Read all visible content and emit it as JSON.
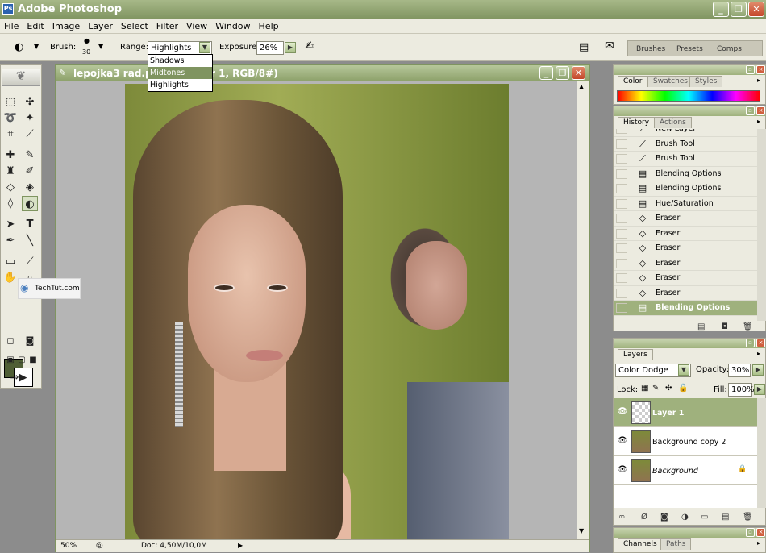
{
  "app": {
    "title": "Adobe Photoshop",
    "logo": "Ps",
    "window_buttons": {
      "minimize": "_",
      "restore": "❐",
      "close": "✕"
    }
  },
  "menu": [
    "File",
    "Edit",
    "Image",
    "Layer",
    "Select",
    "Filter",
    "View",
    "Window",
    "Help"
  ],
  "options": {
    "brush_label": "Brush:",
    "brush_size": "30",
    "range_label": "Range:",
    "range_value": "Highlights",
    "range_options": [
      "Shadows",
      "Midtones",
      "Highlights"
    ],
    "exposure_label": "Exposure:",
    "exposure_value": "26%",
    "well_tabs": [
      "Brushes",
      "Presets",
      "Comps"
    ]
  },
  "document": {
    "title": "lepojka3 rad.psd",
    "title_tail": "r 1, RGB/8#)",
    "zoom": "50%",
    "doc_info": "Doc: 4,50M/10,0M"
  },
  "watermark": "TechTut.com",
  "color_palette": {
    "tabs": [
      "Color",
      "Swatches",
      "Styles"
    ]
  },
  "history": {
    "tabs": [
      "History",
      "Actions"
    ],
    "items": [
      {
        "icon": "brush-icon",
        "label": "New Layer"
      },
      {
        "icon": "brush-icon",
        "label": "Brush Tool"
      },
      {
        "icon": "brush-icon",
        "label": "Brush Tool"
      },
      {
        "icon": "doc-icon",
        "label": "Blending Options"
      },
      {
        "icon": "doc-icon",
        "label": "Blending Options"
      },
      {
        "icon": "doc-icon",
        "label": "Hue/Saturation"
      },
      {
        "icon": "eraser-icon",
        "label": "Eraser"
      },
      {
        "icon": "eraser-icon",
        "label": "Eraser"
      },
      {
        "icon": "eraser-icon",
        "label": "Eraser"
      },
      {
        "icon": "eraser-icon",
        "label": "Eraser"
      },
      {
        "icon": "eraser-icon",
        "label": "Eraser"
      },
      {
        "icon": "eraser-icon",
        "label": "Eraser"
      },
      {
        "icon": "doc-icon",
        "label": "Blending Options"
      }
    ],
    "selected_index": 12
  },
  "layers": {
    "tab": "Layers",
    "blend_mode": "Color Dodge",
    "opacity_label": "Opacity:",
    "opacity_value": "30%",
    "lock_label": "Lock:",
    "fill_label": "Fill:",
    "fill_value": "100%",
    "items": [
      {
        "name": "Layer 1",
        "selected": true
      },
      {
        "name": "Background copy 2",
        "selected": false
      },
      {
        "name": "Background",
        "selected": false,
        "locked": true
      }
    ]
  },
  "channels": {
    "tabs": [
      "Channels",
      "Paths"
    ]
  },
  "colors": {
    "accent": "#7f9460",
    "fg": "#4f5e35",
    "bg": "#ffffff"
  }
}
